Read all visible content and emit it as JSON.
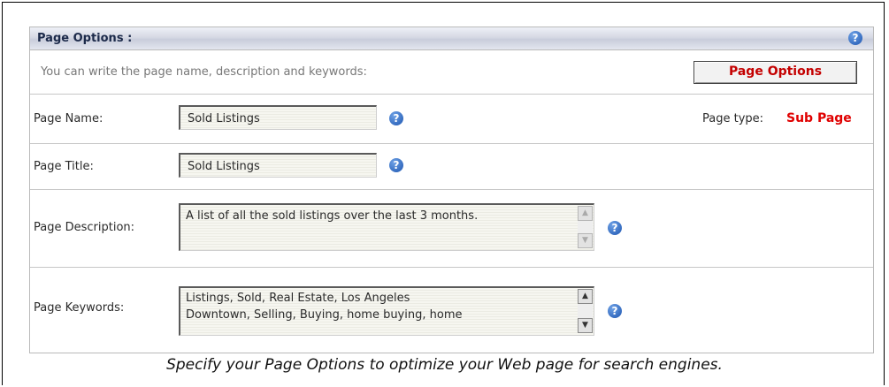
{
  "header": {
    "title": "Page Options :"
  },
  "intro": {
    "text": "You can write the page name, description and keywords:",
    "button_label": "Page Options"
  },
  "page_name": {
    "label": "Page Name:",
    "value": "Sold Listings"
  },
  "page_type": {
    "label": "Page type:",
    "value": "Sub Page"
  },
  "page_title": {
    "label": "Page Title:",
    "value": "Sold Listings"
  },
  "page_description": {
    "label": "Page Description:",
    "value": "A list of all the sold listings over the last 3 months."
  },
  "page_keywords": {
    "label": "Page Keywords:",
    "line1": "Listings, Sold, Real Estate, Los Angeles",
    "line2": "Downtown, Selling, Buying, home buying, home"
  },
  "help_glyph": "?",
  "caption": "Specify your Page Options to optimize your Web page for search engines.",
  "icons": {
    "help": "help-icon",
    "scroll_up": "scroll-up-icon",
    "scroll_down": "scroll-down-icon"
  },
  "colors": {
    "accent_red": "#c40000",
    "help_blue": "#1d55b0"
  }
}
